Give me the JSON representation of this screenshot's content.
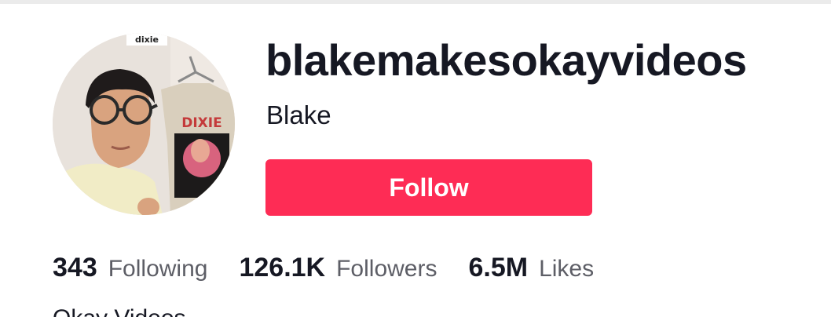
{
  "profile": {
    "username": "blakemakesokayvideos",
    "display_name": "Blake",
    "avatar_sticker_text": "dixie",
    "avatar_shirt_text": "DIXIE",
    "follow_label": "Follow",
    "bio": "Okay Videos"
  },
  "stats": [
    {
      "count": "343",
      "label": "Following"
    },
    {
      "count": "126.1K",
      "label": "Followers"
    },
    {
      "count": "6.5M",
      "label": "Likes"
    }
  ],
  "colors": {
    "accent": "#fe2c55",
    "text_primary": "#161823",
    "text_secondary": "#5d5e66"
  }
}
